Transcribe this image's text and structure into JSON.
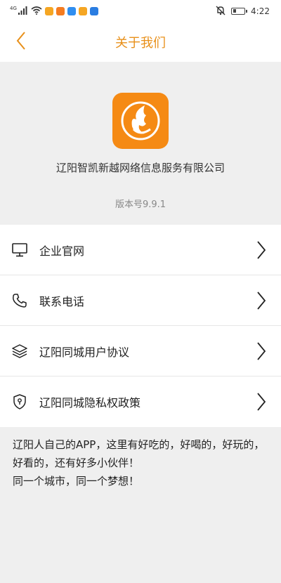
{
  "statusbar": {
    "network": "4G",
    "time": "4:22",
    "icons": [
      "signal-icon",
      "wifi-icon",
      "app-notification-icons",
      "mute-icon",
      "battery-icon"
    ]
  },
  "navbar": {
    "title": "关于我们",
    "back_icon": "chevron-left-icon"
  },
  "about": {
    "company_name": "辽阳智凯新越网络信息服务有限公司",
    "version": "版本号9.9.1"
  },
  "menu": {
    "items": [
      {
        "label": "企业官网",
        "icon": "monitor-icon"
      },
      {
        "label": "联系电话",
        "icon": "phone-icon"
      },
      {
        "label": "辽阳同城用户协议",
        "icon": "layers-icon"
      },
      {
        "label": "辽阳同城隐私权政策",
        "icon": "shield-icon"
      }
    ]
  },
  "footer": {
    "line1": "辽阳人自己的APP，这里有好吃的，好喝的，好玩的，好看的，还有好多小伙伴！",
    "line2": "同一个城市，同一个梦想！"
  },
  "colors": {
    "accent": "#e8901a",
    "logo_bg": "#f58a14",
    "background": "#efefef"
  }
}
